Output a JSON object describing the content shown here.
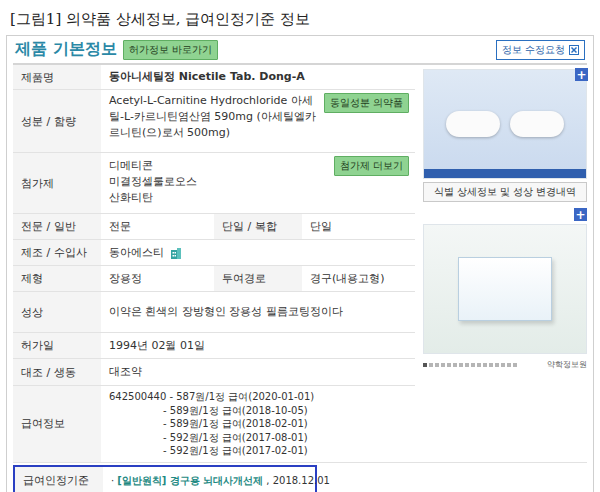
{
  "caption": "[그림1] 의약품 상세정보, 급여인정기준 정보",
  "panel": {
    "title": "제품 기본정보",
    "permit_link": "허가정보 바로가기",
    "edit_request": "정보 수정요청"
  },
  "rows": [
    {
      "kind": "text",
      "label": "제품명",
      "value": "동아니세틸정 Nicetile Tab. Dong-A",
      "bold": true
    },
    {
      "kind": "text",
      "label": "성분 / 함량",
      "value": "Acetyl-L-Carnitine Hydrochloride  아세틸-L-카르니틴염산염  590mg (아세틸엘카르니틴(으)로서 500mg)",
      "bold": false,
      "button": "동일성분 의약품"
    },
    {
      "kind": "lines",
      "label": "첨가제",
      "lines": [
        "디메티콘",
        "미결정셀룰로오스",
        "산화티탄"
      ],
      "button": "첨가제 더보기"
    },
    {
      "kind": "pair",
      "label": "전문 / 일반",
      "value": "전문",
      "label2": "단일 / 복합",
      "value2": "단일"
    },
    {
      "kind": "company",
      "label": "제조 / 수입사",
      "value": "동아에스티"
    },
    {
      "kind": "pair",
      "label": "제형",
      "value": "장용정",
      "label2": "투여경로",
      "value2": "경구(내용고형)"
    },
    {
      "kind": "text",
      "label": "성상",
      "value": "이약은 흰색의 장방형인 장용성 필름코팅정이다",
      "bold": false
    },
    {
      "kind": "text",
      "label": "허가일",
      "value": "1994년 02월 01일",
      "bold": false
    },
    {
      "kind": "text",
      "label": "대조 / 생동",
      "value": "대조약",
      "bold": false
    }
  ],
  "coverage": {
    "label": "급여정보",
    "code": "642500440",
    "entries": [
      "- 587원/1정 급여(2020-01-01)",
      "- 589원/1정 급여(2018-10-05)",
      "- 589원/1정 급여(2018-02-01)",
      "- 592원/1정 급여(2017-08-01)",
      "- 592원/1정 급여(2017-02-01)"
    ]
  },
  "criteria": {
    "label": "급여인정기준",
    "bullet": "·",
    "link": "[일반원칙] 경구용 뇌대사개선제",
    "date": " , 2018.12.01",
    "highlighted": true
  },
  "media": {
    "expand": "+",
    "detail_button": "식별 상세정보 및 성상 변경내역",
    "source": "약학정보원",
    "dots": [
      {
        "selected": true
      },
      {
        "selected": false
      },
      {
        "selected": false
      },
      {
        "selected": false
      },
      {
        "selected": false
      },
      {
        "selected": false
      },
      {
        "selected": false
      },
      {
        "selected": false
      },
      {
        "selected": false
      },
      {
        "selected": false
      },
      {
        "selected": false
      },
      {
        "selected": false
      },
      {
        "selected": false
      },
      {
        "selected": false
      },
      {
        "selected": false
      },
      {
        "selected": false
      }
    ]
  }
}
